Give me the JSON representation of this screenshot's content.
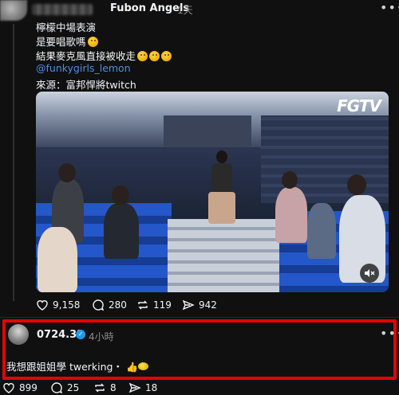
{
  "post": {
    "author": "Fubon Angels",
    "time": "1天",
    "more_icon": "more-dots-icon",
    "lines": [
      "檸檬中場表演",
      "是要唱歌嗎",
      "結果麥克風直接被收走",
      "@funkygirls_lemon",
      "來源：富邦悍將twitch"
    ],
    "video": {
      "watermark": "FGTV",
      "mute_icon": "speaker-muted-icon"
    },
    "stats": {
      "likes": "9,158",
      "comments": "280",
      "reposts": "119",
      "shares": "942"
    }
  },
  "reply": {
    "author": "0724.32",
    "time": "4小時",
    "text": "我想跟姐姐學 twerking",
    "text_suffix": "・",
    "stats": {
      "likes": "899",
      "comments": "25",
      "reposts": "8",
      "shares": "18"
    }
  },
  "colors": {
    "background": "#101010",
    "link": "#4a90e2",
    "highlight_border": "#e10600",
    "verified": "#1d9bf0"
  }
}
